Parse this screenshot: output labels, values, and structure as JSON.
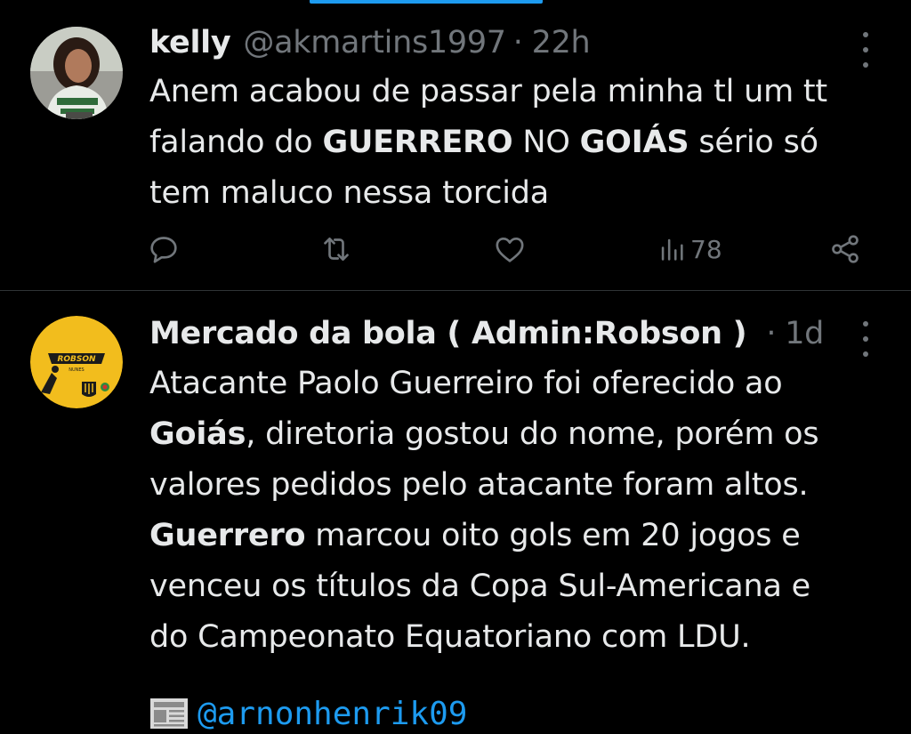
{
  "tweets": [
    {
      "name": "kelly",
      "handle": "@akmartins1997",
      "time": "22h",
      "text": [
        [
          "Anem acabou de passar pela minha tl um tt",
          ""
        ],
        [
          "falando do ",
          ""
        ],
        [
          "GUERRERO",
          "b"
        ],
        [
          " NO ",
          ""
        ],
        [
          "GOIÁS",
          "b"
        ],
        [
          " sério só",
          ""
        ],
        [
          "tem maluco nessa torcida",
          ""
        ]
      ],
      "views": "78"
    },
    {
      "name": "Mercado da bola ( Admin:Robson )",
      "time": "1d",
      "avatar_text_top": "ROBSON",
      "avatar_text_bottom": "NUNES",
      "text": [
        "Atacante Paolo Guerreiro foi oferecido ao",
        "Goiás",
        ", diretoria gostou do nome, porém os",
        "valores pedidos pelo atacante foram altos.",
        "Guerrero",
        " marcou oito gols em 20 jogos e",
        "venceu os títulos da Copa Sul-Americana e",
        "do Campeonato Equatoriano com LDU."
      ],
      "mention": "@arnonhenrik09"
    }
  ],
  "icons": [
    "reply-icon",
    "retweet-icon",
    "like-icon",
    "views-icon",
    "share-icon",
    "more-icon",
    "newspaper-icon"
  ],
  "colors": {
    "background": "#000000",
    "text": "#e7e9ea",
    "muted": "#71767b",
    "link": "#1d9bf0"
  }
}
